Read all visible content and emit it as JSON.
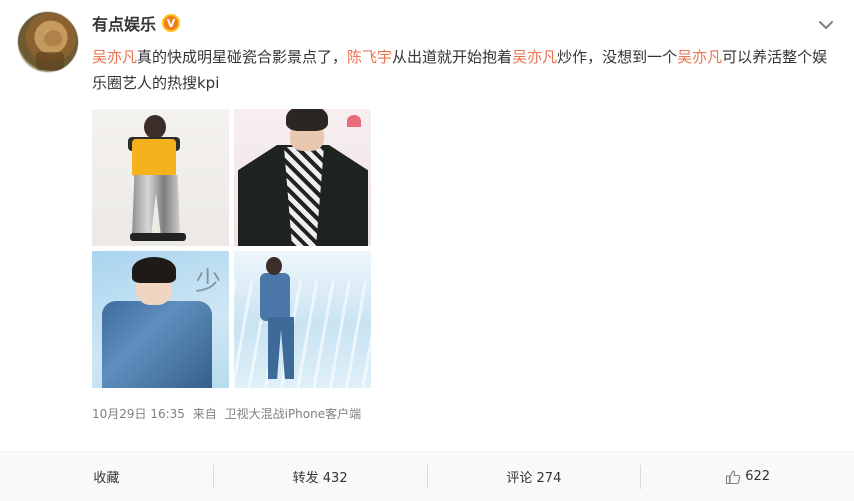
{
  "post": {
    "author": "有点娱乐",
    "verified_badge": "V",
    "text_segments": [
      {
        "text": "吴亦凡",
        "type": "mention"
      },
      {
        "text": "真的快成明星碰瓷合影景点了，",
        "type": "plain"
      },
      {
        "text": "陈飞宇",
        "type": "mention"
      },
      {
        "text": "从出道就开始抱着",
        "type": "plain"
      },
      {
        "text": "吴亦凡",
        "type": "mention"
      },
      {
        "text": "炒作，没想到一个",
        "type": "plain"
      },
      {
        "text": "吴亦凡",
        "type": "mention"
      },
      {
        "text": "可以养活整个娱乐圈艺人的热搜kpi",
        "type": "plain"
      }
    ],
    "date": "10月29日 16:35",
    "source_prefix": "来自",
    "source": "卫视大混战iPhone客户端"
  },
  "actions": {
    "favorite": "收藏",
    "repost": "转发 432",
    "comment": "评论 274",
    "like": "622"
  },
  "icons": {
    "menu": "chevron-down-icon",
    "like": "thumbs-up-icon"
  },
  "colors": {
    "mention": "#eb7350",
    "badge": "#f17c1d",
    "meta": "#808080"
  }
}
